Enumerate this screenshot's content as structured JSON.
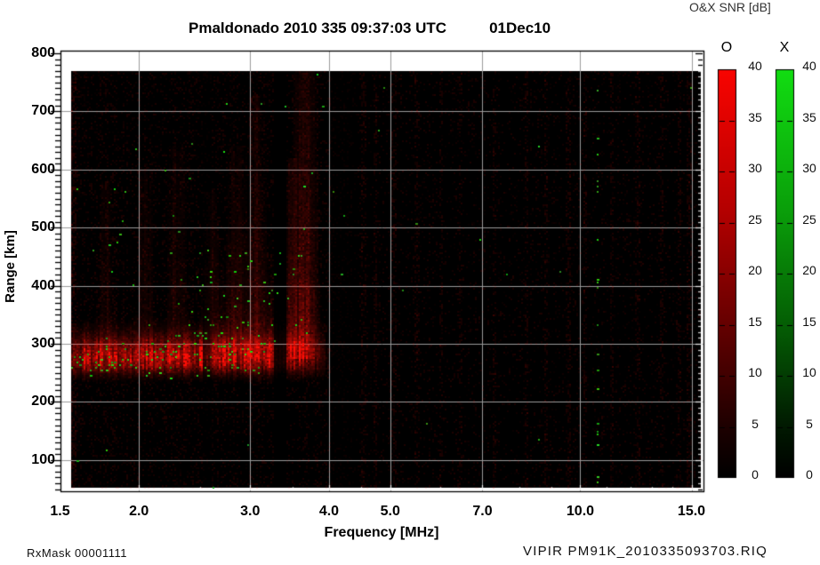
{
  "header": {
    "title_station": "Pmaldonado 2010 335 09:37:03 UTC",
    "title_date": "01Dec10",
    "colorbar_title": "O&X SNR [dB]"
  },
  "footer": {
    "rx_mask": "RxMask 00001111",
    "file_name": "VIPIR  PM91K_2010335093703.RIQ"
  },
  "chart_data": {
    "type": "heatmap",
    "title": "Pmaldonado 2010 335 09:37:03 UTC 01Dec10",
    "xlabel": "Frequency [MHz]",
    "ylabel": "Range [km]",
    "x_scale": "log",
    "xlim": [
      1.5,
      15.0
    ],
    "ylim": [
      46,
      805
    ],
    "x_ticks": [
      1.5,
      2.0,
      3.0,
      4.0,
      5.0,
      7.0,
      10.0,
      15.0
    ],
    "x_tick_labels": [
      "1.5",
      "2.0",
      "3.0",
      "4.0",
      "5.0",
      "7.0",
      "10.0",
      "15.0"
    ],
    "y_ticks": [
      100,
      200,
      300,
      400,
      500,
      600,
      700,
      800
    ],
    "grid": true,
    "grid_color": "#9b9b9b",
    "background_color": "#000000",
    "colorbars": [
      {
        "label": "O",
        "mode": "O-mode SNR",
        "unit": "dB",
        "min": 0,
        "max": 40,
        "tick_step": 5,
        "top_color": "#f90400"
      },
      {
        "label": "X",
        "mode": "X-mode SNR",
        "unit": "dB",
        "min": 0,
        "max": 40,
        "tick_step": 5,
        "top_color": "#12dd12"
      }
    ],
    "features": {
      "seed": 335,
      "o_trace": {
        "freq_mhz": [
          1.55,
          4.0
        ],
        "center_km": 273,
        "range_km": [
          245,
          310
        ],
        "peak_snr_db": 35
      },
      "spread_f": {
        "freq_mhz": [
          2.45,
          3.95
        ],
        "range_km": [
          288,
          490
        ],
        "snr_db": 18
      },
      "plumes": [
        {
          "f": 3.66,
          "w": 0.09,
          "top_km": 768,
          "amp": 0.45
        },
        {
          "f": 3.5,
          "w": 0.05,
          "top_km": 620,
          "amp": 0.3
        },
        {
          "f": 3.07,
          "w": 0.06,
          "top_km": 730,
          "amp": 0.24
        },
        {
          "f": 2.86,
          "w": 0.05,
          "top_km": 640,
          "amp": 0.22
        },
        {
          "f": 2.6,
          "w": 0.04,
          "top_km": 560,
          "amp": 0.18
        },
        {
          "f": 2.3,
          "w": 0.05,
          "top_km": 640,
          "amp": 0.16
        },
        {
          "f": 2.05,
          "w": 0.04,
          "top_km": 600,
          "amp": 0.13
        },
        {
          "f": 1.78,
          "w": 0.035,
          "top_km": 580,
          "amp": 0.12
        }
      ],
      "gaps_mhz": [
        [
          3.27,
          3.43,
          0.12
        ],
        [
          2.52,
          2.6,
          0.4
        ],
        [
          4.02,
          4.45,
          0.5
        ]
      ],
      "faint_columns_mhz": [
        4.52,
        4.72,
        5.05,
        5.5,
        6.0,
        6.45,
        7.3,
        8.2,
        8.8,
        9.55,
        10.15,
        11.2,
        12.3,
        13.4,
        14.3,
        14.85
      ],
      "x_speckle_regions": [
        {
          "freq_mhz": [
            1.55,
            3.25
          ],
          "range_km": [
            243,
            338
          ],
          "density": 0.1,
          "center_km": 283,
          "sigma_km": 45
        },
        {
          "freq_mhz": [
            2.3,
            3.72
          ],
          "range_km": [
            300,
            465
          ],
          "density": 0.028
        },
        {
          "freq_mhz": [
            1.7,
            3.2
          ],
          "range_km": [
            460,
            655
          ],
          "density": 0.005
        }
      ],
      "x_line_mhz": 10.62
    }
  }
}
